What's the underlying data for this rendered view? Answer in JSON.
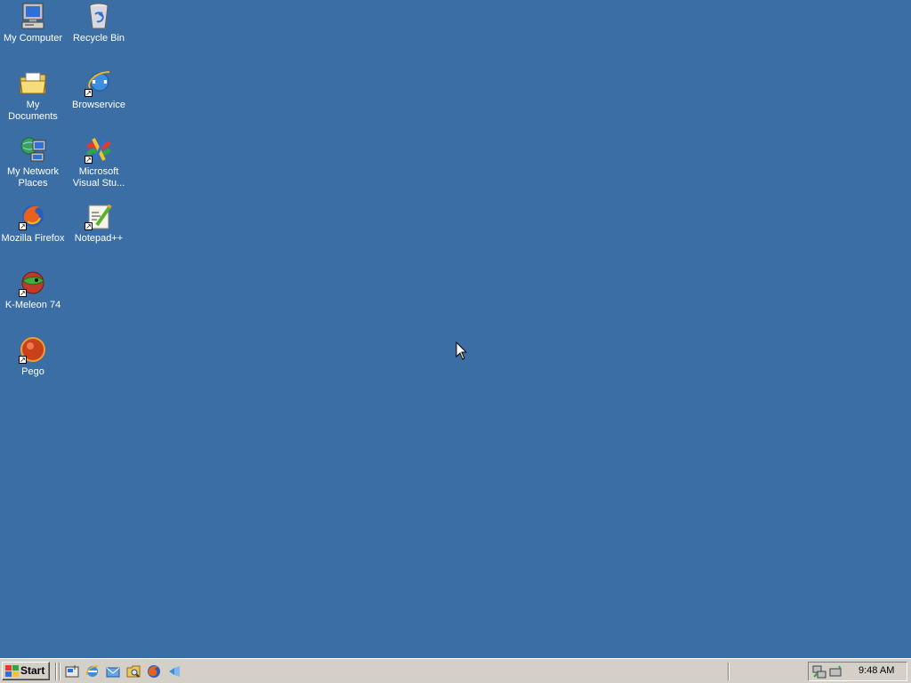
{
  "desktop": {
    "background": "#3a6ea5",
    "icons": [
      {
        "label": "My Computer"
      },
      {
        "label": "Recycle Bin"
      },
      {
        "label": "My Documents"
      },
      {
        "label": "Browservice"
      },
      {
        "label": "My Network Places"
      },
      {
        "label": "Microsoft Visual Stu..."
      },
      {
        "label": "Mozilla Firefox"
      },
      {
        "label": "Notepad++"
      },
      {
        "label": "K-Meleon 74"
      },
      {
        "label": "Pego"
      }
    ]
  },
  "taskbar": {
    "start_label": "Start",
    "quick_launch": [
      "show-desktop-icon",
      "internet-explorer-icon",
      "outlook-express-icon",
      "windows-explorer-icon",
      "firefox-icon",
      "visual-studio-icon"
    ],
    "tray": {
      "icons": [
        "network-icon",
        "safely-remove-hardware-icon"
      ],
      "clock": "9:48 AM"
    }
  }
}
